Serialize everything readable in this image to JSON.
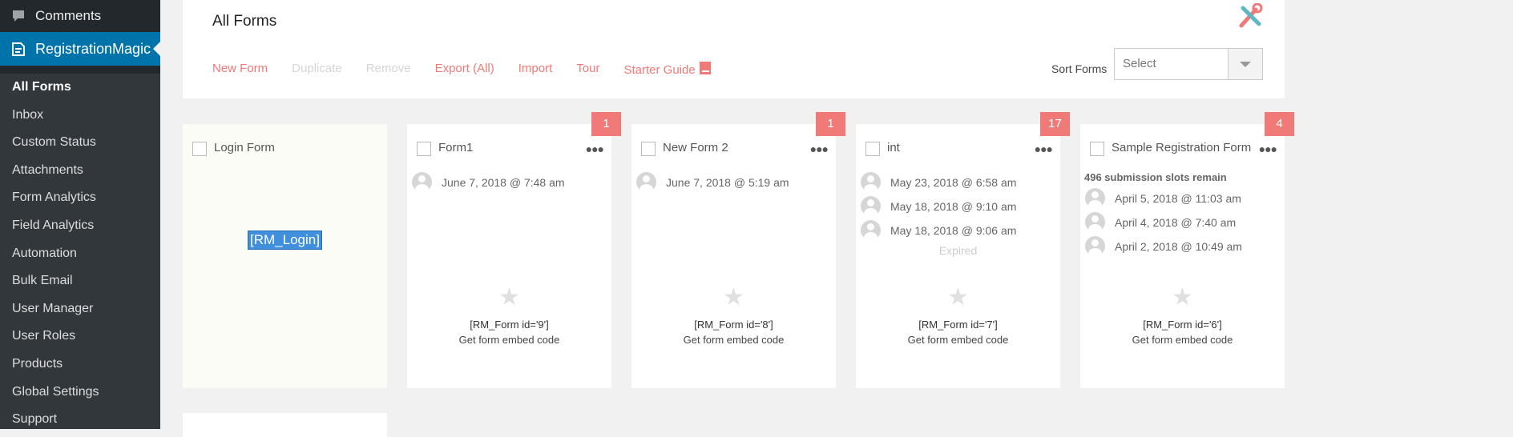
{
  "sidebar": {
    "comments_label": "Comments",
    "plugin_label": "RegistrationMagic",
    "items": [
      {
        "label": "All Forms",
        "active": true
      },
      {
        "label": "Inbox"
      },
      {
        "label": "Custom Status"
      },
      {
        "label": "Attachments"
      },
      {
        "label": "Form Analytics"
      },
      {
        "label": "Field Analytics"
      },
      {
        "label": "Automation"
      },
      {
        "label": "Bulk Email"
      },
      {
        "label": "User Manager"
      },
      {
        "label": "User Roles"
      },
      {
        "label": "Products"
      },
      {
        "label": "Global Settings"
      },
      {
        "label": "Support"
      }
    ]
  },
  "header": {
    "title": "All Forms",
    "toolbar": {
      "new_form": "New Form",
      "duplicate": "Duplicate",
      "remove": "Remove",
      "export": "Export (All)",
      "import": "Import",
      "tour": "Tour",
      "starter_guide": "Starter Guide"
    },
    "sort": {
      "label": "Sort Forms",
      "value": "Select"
    }
  },
  "cards": [
    {
      "title": "Login Form",
      "shortcode": "[RM_Login]"
    },
    {
      "title": "Form1",
      "badge": "1",
      "entries": [
        "June 7, 2018 @ 7:48 am"
      ],
      "shortcode": "[RM_Form id='9']",
      "embed": "Get form embed code"
    },
    {
      "title": "New Form 2",
      "badge": "1",
      "entries": [
        "June 7, 2018 @ 5:19 am"
      ],
      "shortcode": "[RM_Form id='8']",
      "embed": "Get form embed code"
    },
    {
      "title": "int",
      "badge": "17",
      "entries": [
        "May 23, 2018 @ 6:58 am",
        "May 18, 2018 @ 9:10 am",
        "May 18, 2018 @ 9:06 am"
      ],
      "status": "Expired",
      "shortcode": "[RM_Form id='7']",
      "embed": "Get form embed code"
    },
    {
      "title": "Sample Registration Form",
      "badge": "4",
      "slots": "496 submission slots remain",
      "entries": [
        "April 5, 2018 @ 11:03 am",
        "April 4, 2018 @ 7:40 am",
        "April 2, 2018 @ 10:49 am"
      ],
      "shortcode": "[RM_Form id='6']",
      "embed": "Get form embed code"
    }
  ],
  "colors": {
    "accent": "#f07a78",
    "sidebar": "#23282d",
    "wp_blue": "#0073aa",
    "highlight": "#3f8fdc"
  },
  "icons": {
    "comments": "speech-bubble-icon",
    "plugin": "registrationmagic-icon",
    "tools": "wrench-screwdriver-icon",
    "guide": "book-icon",
    "star": "star-icon",
    "more": "more-dots-icon"
  }
}
